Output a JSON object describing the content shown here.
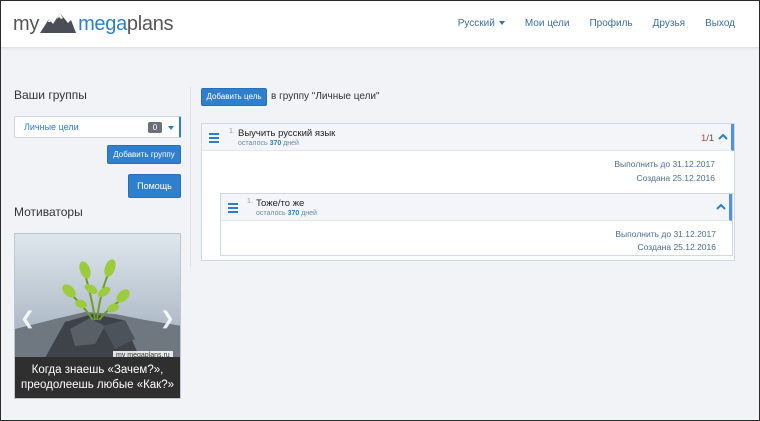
{
  "header": {
    "logo": {
      "my": "my",
      "mega": "mega",
      "plans": "plans"
    },
    "nav": [
      {
        "label": "Русский",
        "dropdown": true
      },
      {
        "label": "Мои цели"
      },
      {
        "label": "Профиль"
      },
      {
        "label": "Друзья"
      },
      {
        "label": "Выход"
      }
    ]
  },
  "sidebar": {
    "groups_title": "Ваши группы",
    "selected_group": {
      "label": "Личные цели",
      "count": "0"
    },
    "add_group_label": "Добавить группу",
    "help_label": "Помощь",
    "motivators_title": "Мотиваторы",
    "motivator": {
      "watermark": "my megaplans.ru",
      "caption_line1": "Когда знаешь «Зачем?»,",
      "caption_line2": "преодолеешь любые «Как?»"
    }
  },
  "main": {
    "add_goal_label": "Добавить цель",
    "to_group_text": "в группу \"Личные цели\"",
    "goals": [
      {
        "index": "1.",
        "title": "Выучить русский язык",
        "remain_prefix": "осталось",
        "remain_days": "370",
        "remain_suffix": "дней",
        "ratio_done": "1",
        "ratio_total": "/1",
        "deadline": "Выполнить до 31.12.2017",
        "created": "Создана 25.12.2016"
      },
      {
        "index": "1.",
        "title": "Тоже/то же",
        "remain_prefix": "осталось",
        "remain_days": "370",
        "remain_suffix": "дней",
        "deadline": "Выполнить до 31.12.2017",
        "created": "Создана 25.12.2016"
      }
    ]
  },
  "colors": {
    "accent": "#2a7fc9",
    "button": "#2f7fcf",
    "background": "#f2f3f7"
  }
}
